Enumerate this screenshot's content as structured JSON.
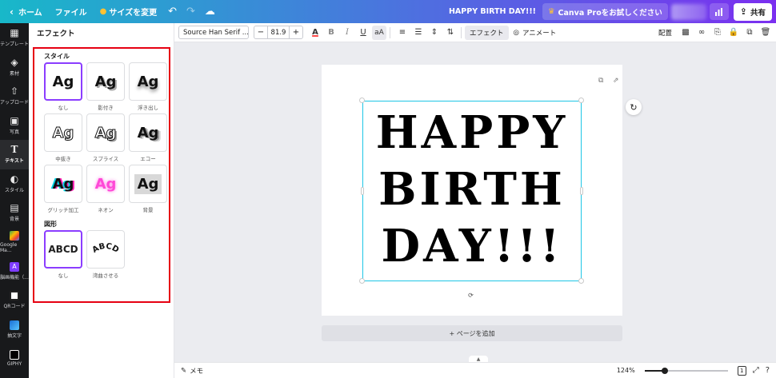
{
  "topbar": {
    "home": "ホーム",
    "file": "ファイル",
    "resize": "サイズを変更",
    "doc_title": "HAPPY BIRTH DAY!!!",
    "pro_cta": "Canva Proをお試しください",
    "share": "共有"
  },
  "rail": {
    "items": [
      {
        "label": "テンプレート",
        "icon": "template-icon"
      },
      {
        "label": "素材",
        "icon": "elements-icon"
      },
      {
        "label": "アップロード",
        "icon": "upload-icon"
      },
      {
        "label": "写真",
        "icon": "photos-icon"
      },
      {
        "label": "テキスト",
        "icon": "text-icon"
      },
      {
        "label": "スタイル",
        "icon": "styles-icon"
      },
      {
        "label": "背景",
        "icon": "background-icon"
      },
      {
        "label": "Google Ma...",
        "icon": "google-maps-icon"
      },
      {
        "label": "脳画機能（...",
        "icon": "app-icon"
      },
      {
        "label": "QRコード",
        "icon": "qr-icon"
      },
      {
        "label": "抽文字",
        "icon": "app-icon"
      },
      {
        "label": "GIPHY",
        "icon": "giphy-icon"
      }
    ]
  },
  "panel": {
    "title": "エフェクト",
    "style_heading": "スタイル",
    "shape_heading": "図形",
    "sample_text": "Ag",
    "shape_sample": "ABCD",
    "styles": [
      "なし",
      "影付き",
      "浮き出し",
      "中抜き",
      "スプライス",
      "エコー",
      "グリッチ加工",
      "ネオン",
      "背景"
    ],
    "shapes": [
      "なし",
      "湾曲させる"
    ]
  },
  "toolbar": {
    "font": "Source Han Serif ...",
    "minus": "−",
    "font_size": "81.9",
    "plus": "+",
    "effects": "エフェクト",
    "animate": "アニメート",
    "position": "配置"
  },
  "canvas": {
    "text_line1": "HAPPY",
    "text_line2": "BIRTH",
    "text_line3": "DAY!!!",
    "add_page": "+ ページを追加"
  },
  "bottombar": {
    "notes": "メモ",
    "zoom": "124%",
    "zoom_level": 0.24,
    "page_indicator": "1"
  },
  "colors": {
    "selection_border": "#1ec6e6",
    "selected_tile": "#8b3dff",
    "highlight_box": "#e60012"
  }
}
